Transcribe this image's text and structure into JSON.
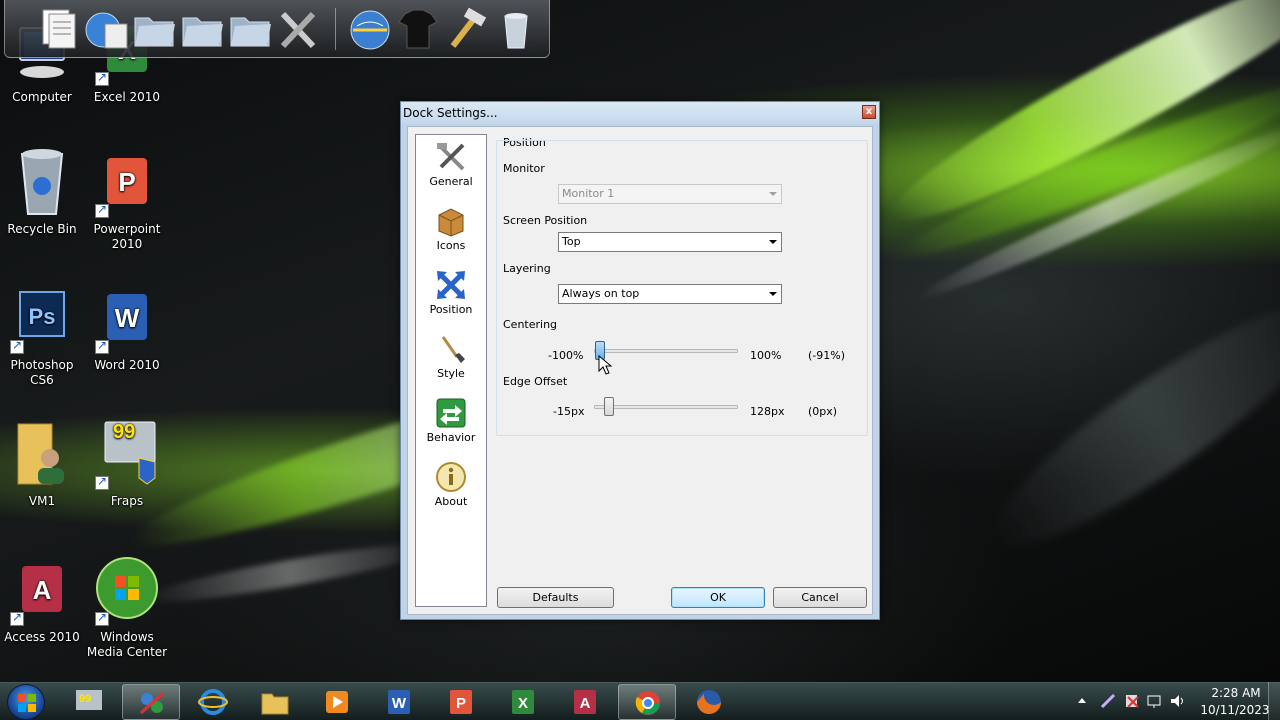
{
  "desktop": {
    "icons": [
      {
        "label": "Computer",
        "icon": "computer-icon"
      },
      {
        "label": "Excel 2010",
        "icon": "excel-icon"
      },
      {
        "label": "Recycle Bin",
        "icon": "recycle-bin-icon"
      },
      {
        "label": "Powerpoint 2010",
        "icon": "powerpoint-icon"
      },
      {
        "label": "Photoshop CS6",
        "icon": "photoshop-icon"
      },
      {
        "label": "Word 2010",
        "icon": "word-icon"
      },
      {
        "label": "VM1",
        "icon": "user-folder-icon"
      },
      {
        "label": "Fraps",
        "icon": "fraps-icon"
      },
      {
        "label": "Access 2010",
        "icon": "access-icon"
      },
      {
        "label": "Windows Media Center",
        "icon": "media-center-icon"
      }
    ]
  },
  "dock": {
    "icons": [
      "documents-icon",
      "web-icon",
      "folder-icon",
      "folder-icon",
      "folder-icon",
      "tools-icon",
      "globe-icon",
      "tshirt-icon",
      "hammer-icon",
      "trash-icon"
    ]
  },
  "dialog": {
    "title": "Dock Settings...",
    "close_label": "x",
    "nav": [
      {
        "label": "General",
        "icon": "tools-icon"
      },
      {
        "label": "Icons",
        "icon": "box-icon"
      },
      {
        "label": "Position",
        "icon": "arrows-icon"
      },
      {
        "label": "Style",
        "icon": "brush-icon"
      },
      {
        "label": "Behavior",
        "icon": "behavior-icon"
      },
      {
        "label": "About",
        "icon": "info-icon"
      }
    ],
    "panel": {
      "group_title": "Position",
      "monitor_label": "Monitor",
      "monitor_value": "Monitor 1",
      "screen_position_label": "Screen Position",
      "screen_position_value": "Top",
      "layering_label": "Layering",
      "layering_value": "Always on top",
      "centering_label": "Centering",
      "centering_min": "-100%",
      "centering_max": "100%",
      "centering_current": "(-91%)",
      "centering_value": -91,
      "edge_offset_label": "Edge Offset",
      "edge_min": "-15px",
      "edge_max": "128px",
      "edge_current": "(0px)",
      "edge_value": 0
    },
    "buttons": {
      "defaults": "Defaults",
      "ok": "OK",
      "cancel": "Cancel"
    }
  },
  "taskbar": {
    "apps": [
      "fraps-icon",
      "network-icon",
      "ie-icon",
      "explorer-icon",
      "media-player-icon",
      "word-icon",
      "powerpoint-icon",
      "excel-icon",
      "access-icon",
      "chrome-icon",
      "firefox-icon"
    ],
    "clock_time": "2:28 AM",
    "clock_date": "10/11/2023"
  },
  "colors": {
    "accent_green": "#8fd12a",
    "dialog_frame": "#bfd3e9",
    "slider_active": "#6fb0e4"
  }
}
